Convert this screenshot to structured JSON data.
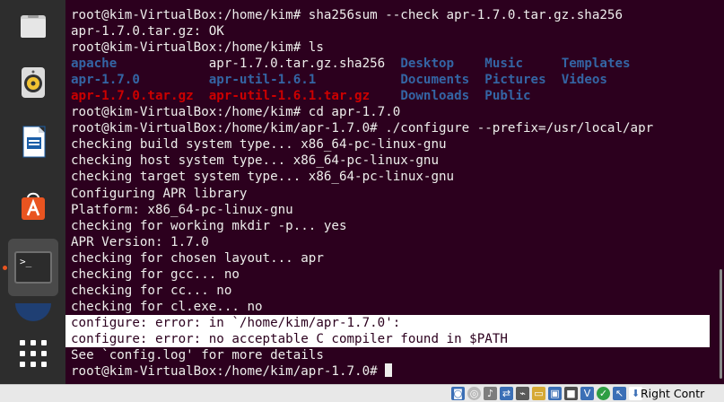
{
  "dock": {
    "items": [
      {
        "name": "files-icon",
        "icon": "folder"
      },
      {
        "name": "rhythmbox-icon",
        "icon": "speaker"
      },
      {
        "name": "writer-icon",
        "icon": "document"
      },
      {
        "name": "software-icon",
        "icon": "bag-a"
      },
      {
        "name": "terminal-icon",
        "icon": "terminal",
        "glyph": ">_"
      },
      {
        "name": "partial-icon",
        "icon": "globe"
      },
      {
        "name": "apps-grid-icon",
        "icon": "grid"
      }
    ]
  },
  "terminal": {
    "lines": [
      {
        "segments": [
          {
            "text": "root@kim-VirtualBox:/home/kim# sha256sum --check apr-1.7.0.tar.gz.sha256",
            "style": "plain"
          }
        ]
      },
      {
        "segments": [
          {
            "text": "apr-1.7.0.tar.gz: OK",
            "style": "plain"
          }
        ]
      },
      {
        "segments": [
          {
            "text": "root@kim-VirtualBox:/home/kim# ls",
            "style": "plain"
          }
        ]
      },
      {
        "segments": [
          {
            "text": "apache",
            "style": "blue"
          },
          {
            "text": "            ",
            "style": "plain"
          },
          {
            "text": "apr-1.7.0.tar.gz.sha256",
            "style": "plain"
          },
          {
            "text": "  ",
            "style": "plain"
          },
          {
            "text": "Desktop",
            "style": "blue"
          },
          {
            "text": "    ",
            "style": "plain"
          },
          {
            "text": "Music",
            "style": "blue"
          },
          {
            "text": "     ",
            "style": "plain"
          },
          {
            "text": "Templates",
            "style": "blue"
          }
        ]
      },
      {
        "segments": [
          {
            "text": "apr-1.7.0",
            "style": "blue"
          },
          {
            "text": "         ",
            "style": "plain"
          },
          {
            "text": "apr-util-1.6.1",
            "style": "blue"
          },
          {
            "text": "           ",
            "style": "plain"
          },
          {
            "text": "Documents",
            "style": "blue"
          },
          {
            "text": "  ",
            "style": "plain"
          },
          {
            "text": "Pictures",
            "style": "blue"
          },
          {
            "text": "  ",
            "style": "plain"
          },
          {
            "text": "Videos",
            "style": "blue"
          }
        ]
      },
      {
        "segments": [
          {
            "text": "apr-1.7.0.tar.gz",
            "style": "red"
          },
          {
            "text": "  ",
            "style": "plain"
          },
          {
            "text": "apr-util-1.6.1.tar.gz",
            "style": "red"
          },
          {
            "text": "    ",
            "style": "plain"
          },
          {
            "text": "Downloads",
            "style": "blue"
          },
          {
            "text": "  ",
            "style": "plain"
          },
          {
            "text": "Public",
            "style": "blue"
          }
        ]
      },
      {
        "segments": [
          {
            "text": "root@kim-VirtualBox:/home/kim# cd apr-1.7.0",
            "style": "plain"
          }
        ]
      },
      {
        "segments": [
          {
            "text": "root@kim-VirtualBox:/home/kim/apr-1.7.0# ./configure --prefix=/usr/local/apr",
            "style": "plain"
          }
        ]
      },
      {
        "segments": [
          {
            "text": "checking build system type... x86_64-pc-linux-gnu",
            "style": "plain"
          }
        ]
      },
      {
        "segments": [
          {
            "text": "checking host system type... x86_64-pc-linux-gnu",
            "style": "plain"
          }
        ]
      },
      {
        "segments": [
          {
            "text": "checking target system type... x86_64-pc-linux-gnu",
            "style": "plain"
          }
        ]
      },
      {
        "segments": [
          {
            "text": "Configuring APR library",
            "style": "plain"
          }
        ]
      },
      {
        "segments": [
          {
            "text": "Platform: x86_64-pc-linux-gnu",
            "style": "plain"
          }
        ]
      },
      {
        "segments": [
          {
            "text": "checking for working mkdir -p... yes",
            "style": "plain"
          }
        ]
      },
      {
        "segments": [
          {
            "text": "APR Version: 1.7.0",
            "style": "plain"
          }
        ]
      },
      {
        "segments": [
          {
            "text": "checking for chosen layout... apr",
            "style": "plain"
          }
        ]
      },
      {
        "segments": [
          {
            "text": "checking for gcc... no",
            "style": "plain"
          }
        ]
      },
      {
        "segments": [
          {
            "text": "checking for cc... no",
            "style": "plain"
          }
        ]
      },
      {
        "segments": [
          {
            "text": "checking for cl.exe... no",
            "style": "plain"
          }
        ]
      },
      {
        "segments": [
          {
            "text": "configure: error: in `/home/kim/apr-1.7.0':",
            "style": "plain"
          }
        ],
        "selected": true
      },
      {
        "segments": [
          {
            "text": "configure: error: no acceptable C compiler found in $PATH",
            "style": "plain"
          }
        ],
        "selected": true
      },
      {
        "segments": [
          {
            "text": "See `config.log' for more details",
            "style": "plain"
          }
        ]
      },
      {
        "segments": [
          {
            "text": "root@kim-VirtualBox:/home/kim/apr-1.7.0# ",
            "style": "plain"
          }
        ],
        "cursor": true
      }
    ],
    "colors": {
      "background": "#2c001e",
      "foreground": "#eeeeec",
      "dir": "#3465a4",
      "archive": "#cc0000"
    }
  },
  "statusbar": {
    "host_key_label": "Right Contr"
  }
}
